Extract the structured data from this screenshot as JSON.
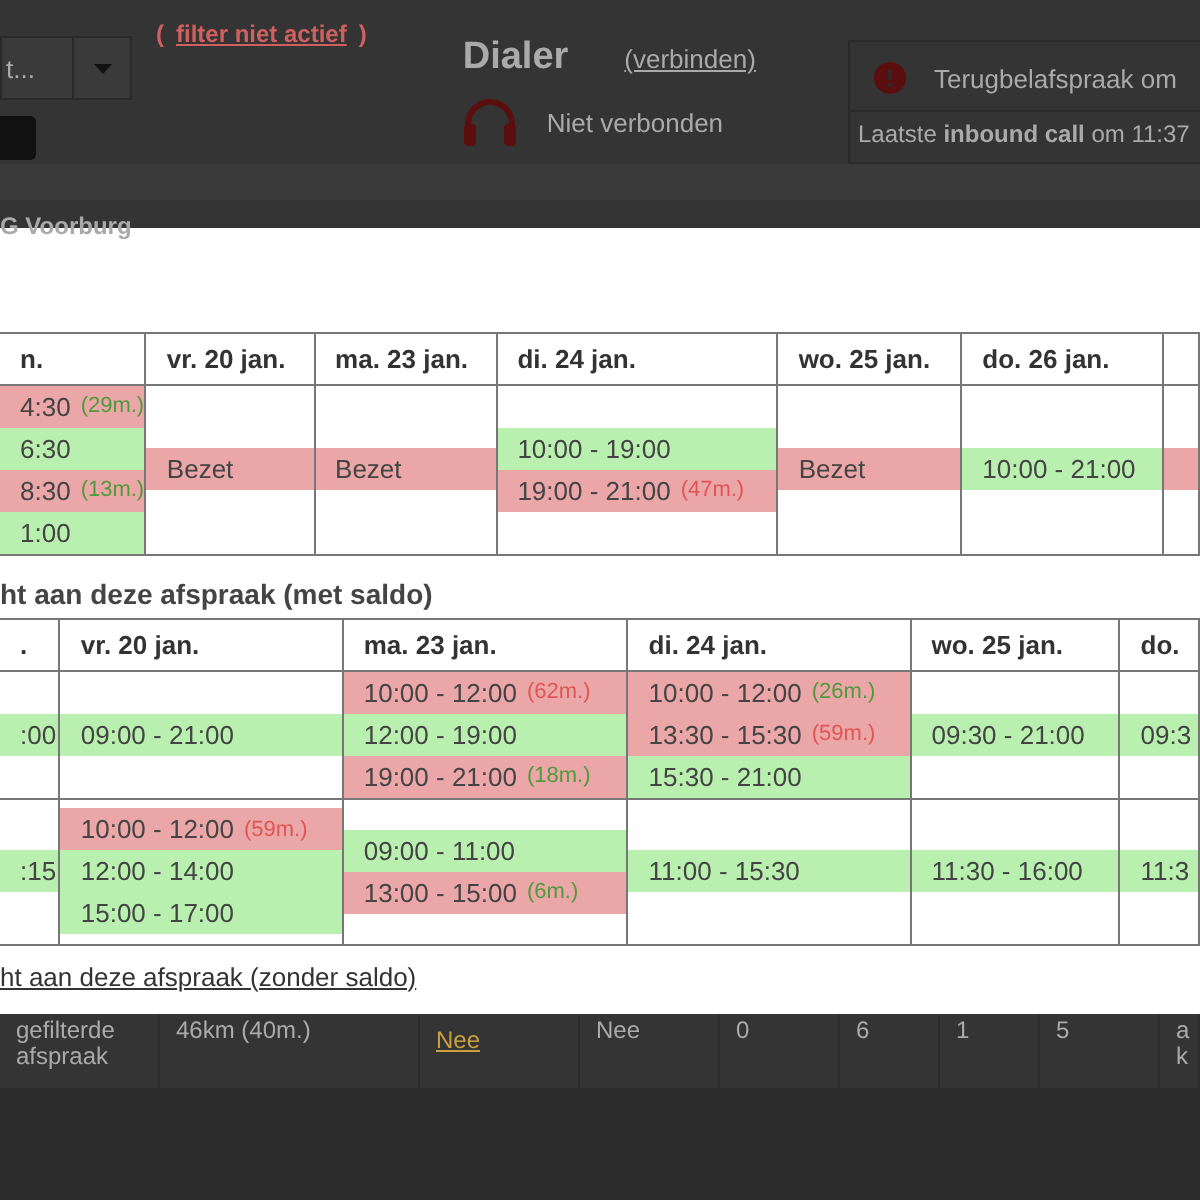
{
  "header": {
    "select_value": "t...",
    "filter_link": "filter niet actief",
    "filter_paren_open": "(",
    "filter_paren_close": ")",
    "dialer_title": "Dialer",
    "dialer_link": "(verbinden)",
    "dialer_status": "Niet verbonden",
    "alert_text": "Terugbelafspraak om",
    "last_call": "Laatste **inbound call** om 11:37",
    "location": "G Voorburg"
  },
  "table_1": {
    "columns": [
      "n.",
      "vr. 20 jan.",
      "ma. 23 jan.",
      "di. 24 jan.",
      "wo. 25 jan.",
      "do. 26 jan.",
      ""
    ],
    "rows": [
      [
        [
          {
            "time": "4:30",
            "kind": "busy",
            "note": {
              "text": "(29m.)",
              "color": "#4f9a3c"
            }
          },
          {
            "time": "6:30",
            "kind": "free"
          },
          {
            "time": "8:30",
            "kind": "busy",
            "note": {
              "text": "(13m.)",
              "color": "#4f9a3c"
            }
          },
          {
            "time": "1:00",
            "kind": "free"
          }
        ],
        [
          {
            "time": "Bezet",
            "kind": "busy"
          }
        ],
        [
          {
            "time": "Bezet",
            "kind": "busy"
          }
        ],
        [
          {
            "time": "10:00 - 19:00",
            "kind": "free"
          },
          {
            "time": "19:00 - 21:00",
            "kind": "busy",
            "note": {
              "text": "(47m.)",
              "color": "#e05555"
            }
          }
        ],
        [
          {
            "time": "Bezet",
            "kind": "busy"
          }
        ],
        [
          {
            "time": "10:00 - 21:00",
            "kind": "free"
          }
        ],
        [
          {
            "kind": "busy"
          }
        ]
      ]
    ]
  },
  "heading_met": "ht aan deze afspraak (met saldo)",
  "table_2": {
    "columns": [
      ".",
      "vr. 20 jan.",
      "ma. 23 jan.",
      "di. 24 jan.",
      "wo. 25 jan.",
      "do."
    ],
    "rows": [
      [
        [
          {
            "time": ":00",
            "kind": "free"
          }
        ],
        [
          {
            "time": "09:00 - 21:00",
            "kind": "free"
          }
        ],
        [
          {
            "time": "10:00 - 12:00",
            "kind": "busy",
            "note": {
              "text": "(62m.)",
              "color": "#e05555"
            }
          },
          {
            "time": "12:00 - 19:00",
            "kind": "free"
          },
          {
            "time": "19:00 - 21:00",
            "kind": "busy",
            "note": {
              "text": "(18m.)",
              "color": "#4f9a3c"
            }
          }
        ],
        [
          {
            "time": "10:00 - 12:00",
            "kind": "busy",
            "note": {
              "text": "(26m.)",
              "color": "#4f9a3c"
            }
          },
          {
            "time": "13:30 - 15:30",
            "kind": "busy",
            "note": {
              "text": "(59m.)",
              "color": "#e05555"
            }
          },
          {
            "time": "15:30 - 21:00",
            "kind": "free"
          }
        ],
        [
          {
            "time": "09:30 - 21:00",
            "kind": "free"
          }
        ],
        [
          {
            "time": "09:3",
            "kind": "free"
          }
        ]
      ],
      [
        [
          {
            "time": ":15",
            "kind": "free"
          }
        ],
        [
          {
            "time": "10:00 - 12:00",
            "kind": "busy",
            "note": {
              "text": "(59m.)",
              "color": "#e05555"
            }
          },
          {
            "time": "12:00 - 14:00",
            "kind": "free"
          },
          {
            "time": "15:00 - 17:00",
            "kind": "free"
          }
        ],
        [
          {
            "time": "09:00 - 11:00",
            "kind": "free"
          },
          {
            "time": "13:00 - 15:00",
            "kind": "busy",
            "note": {
              "text": "(6m.)",
              "color": "#4f9a3c"
            }
          }
        ],
        [
          {
            "time": "11:00 - 15:30",
            "kind": "free"
          }
        ],
        [
          {
            "time": "11:30 - 16:00",
            "kind": "free"
          }
        ],
        [
          {
            "time": "11:3",
            "kind": "free"
          }
        ]
      ]
    ]
  },
  "link_zonder": "ht aan deze afspraak (zonder saldo)",
  "background_row": [
    "gefilterde afspraak",
    "46km (40m.)",
    "Nee",
    "Nee",
    "0",
    "6",
    "1",
    "5",
    "a k"
  ]
}
